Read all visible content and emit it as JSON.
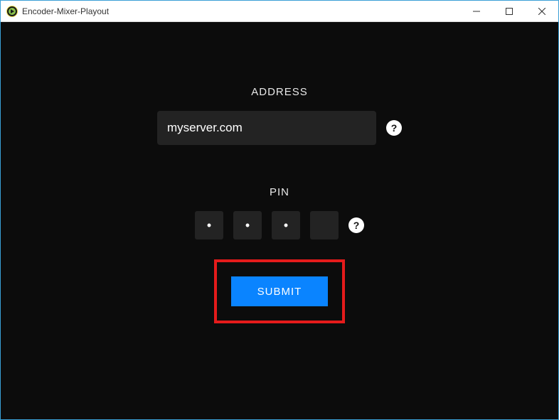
{
  "window": {
    "title": "Encoder-Mixer-Playout"
  },
  "form": {
    "address_label": "ADDRESS",
    "address_value": "myserver.com",
    "pin_label": "PIN",
    "pin_values": [
      "•",
      "•",
      "•",
      ""
    ],
    "submit_label": "SUBMIT"
  },
  "colors": {
    "background": "#0c0c0c",
    "input_bg": "#232323",
    "submit_bg": "#0a84ff",
    "highlight_border": "#e51b1b"
  }
}
